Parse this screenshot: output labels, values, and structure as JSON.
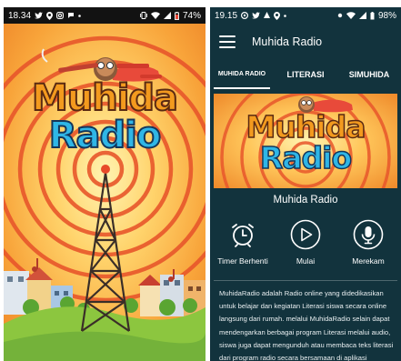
{
  "splash": {
    "status_bar": {
      "time": "18.34",
      "battery": "74%"
    },
    "logo": {
      "line1": "Muhida",
      "line2": "Radio"
    }
  },
  "app": {
    "status_bar": {
      "time": "19.15",
      "battery": "98%"
    },
    "title": "Muhida Radio",
    "tabs": [
      {
        "label": "MUHIDA RADIO",
        "active": true
      },
      {
        "label": "LITERASI",
        "active": false
      },
      {
        "label": "SIMUHIDA",
        "active": false
      }
    ],
    "banner": {
      "line1": "Muhida",
      "line2": "Radio"
    },
    "station_name": "Muhida Radio",
    "controls": [
      {
        "label": "Timer Berhenti",
        "icon": "alarm-clock-icon"
      },
      {
        "label": "Mulai",
        "icon": "play-icon"
      },
      {
        "label": "Merekam",
        "icon": "microphone-icon"
      }
    ],
    "description": "MuhidaRadio adalah Radio online yang didedikasikan untuk belajar dan kegiatan Literasi siswa secara online langsung dari rumah. melalui MuhidaRadio selain dapat mendengarkan berbagai program Literasi melalui audio, siswa juga dapat mengunduh atau membaca teks literasi dari program radio secara bersamaan di aplikasi"
  },
  "colors": {
    "app_bg": "#12333d",
    "splash_orange": "#f5a03c",
    "logo_orange": "#f39a1e",
    "logo_blue": "#2fb6e6",
    "grass": "#8cc63f"
  }
}
